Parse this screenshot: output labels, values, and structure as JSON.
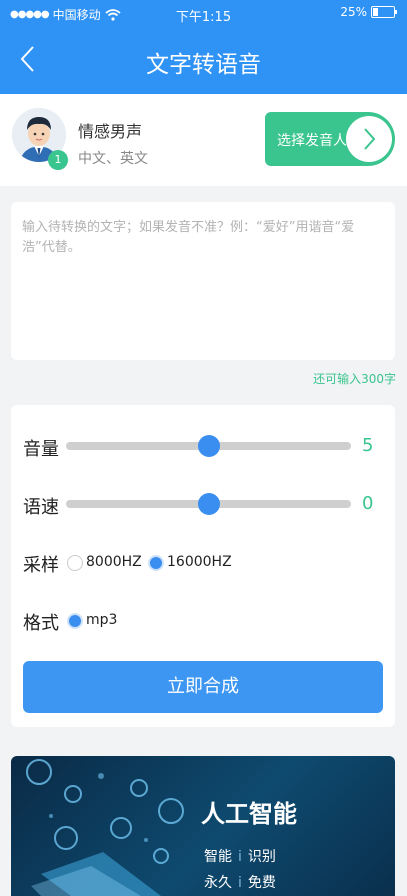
{
  "status_bar": {
    "carrier": "中国移动",
    "time": "下午1:15",
    "battery": "25%",
    "battery_level": 0.25
  },
  "nav": {
    "title": "文字转语音"
  },
  "speaker": {
    "name": "情感男声",
    "languages": "中文、英文",
    "badge": "1",
    "choose_label": "选择发音人"
  },
  "text_input": {
    "placeholder": "输入待转换的文字；如果发音不准？例：“爱好”用谐音“爱浩”代替。",
    "remaining": "还可输入300字"
  },
  "settings": {
    "volume": {
      "label": "音量",
      "value": "5",
      "level": 0.5
    },
    "speed": {
      "label": "语速",
      "value": "0",
      "level": 0.5
    },
    "sample": {
      "label": "采样",
      "options": [
        "8000HZ",
        "16000HZ"
      ],
      "selected": "16000HZ"
    },
    "format": {
      "label": "格式",
      "options": [
        "mp3"
      ],
      "selected": "mp3"
    },
    "synthesize_label": "立即合成"
  },
  "banner": {
    "title": "人工智能",
    "line1_a": "智能",
    "line1_b": "识别",
    "line2_a": "永久",
    "line2_b": "免费",
    "separator": "i"
  },
  "colors": {
    "primary": "#2f92f5",
    "accent": "#3ac48e",
    "slider": "#3a8ef0"
  }
}
